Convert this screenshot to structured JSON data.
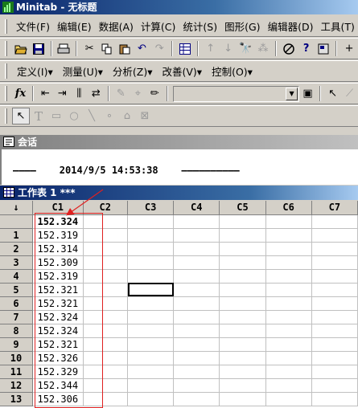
{
  "window": {
    "title": "Minitab - 无标题"
  },
  "menu": [
    "文件(F)",
    "编辑(E)",
    "数据(A)",
    "计算(C)",
    "统计(S)",
    "图形(G)",
    "编辑器(D)",
    "工具(T)"
  ],
  "stat_toolbar": [
    "定义(I)▾",
    "测量(U)▾",
    "分析(Z)▾",
    "改善(V)▾",
    "控制(O)▾"
  ],
  "session": {
    "title": "会话",
    "line": "————    2014/9/5 14:53:38    ——————————"
  },
  "worksheet": {
    "title": "工作表 1 ***",
    "corner": "↓",
    "columns": [
      "C1",
      "C2",
      "C3",
      "C4",
      "C5",
      "C6",
      "C7"
    ],
    "name_row": [
      "152.324",
      "",
      "",
      "",
      "",
      "",
      ""
    ],
    "rows": [
      {
        "n": "1",
        "v": "152.319"
      },
      {
        "n": "2",
        "v": "152.314"
      },
      {
        "n": "3",
        "v": "152.309"
      },
      {
        "n": "4",
        "v": "152.319"
      },
      {
        "n": "5",
        "v": "152.321"
      },
      {
        "n": "6",
        "v": "152.321"
      },
      {
        "n": "7",
        "v": "152.324"
      },
      {
        "n": "8",
        "v": "152.324"
      },
      {
        "n": "9",
        "v": "152.321"
      },
      {
        "n": "10",
        "v": "152.326"
      },
      {
        "n": "11",
        "v": "152.329"
      },
      {
        "n": "12",
        "v": "152.344"
      },
      {
        "n": "13",
        "v": "152.306"
      }
    ]
  },
  "colors": {
    "title_active": "#0a246a",
    "annotation": "#e02020",
    "face": "#d4d0c8"
  }
}
